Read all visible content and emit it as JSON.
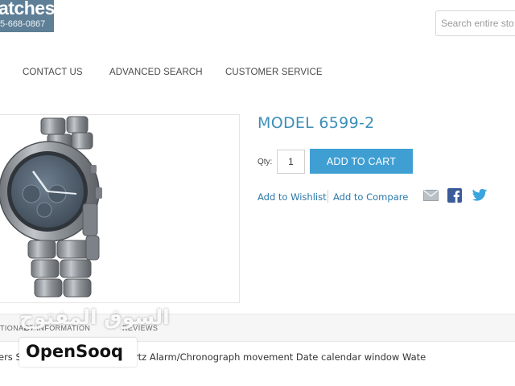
{
  "header": {
    "logo_text": "atches",
    "phone": "5-668-0867",
    "search_placeholder": "Search entire sto"
  },
  "nav": {
    "items": [
      "CONTACT US",
      "ADVANCED SEARCH",
      "CUSTOMER SERVICE"
    ]
  },
  "product": {
    "title": "MODEL 6599-2",
    "qty_label": "Qty:",
    "qty_value": "1",
    "add_to_cart": "ADD TO CART",
    "wishlist": "Add to Wishlist",
    "compare": "Add to Compare"
  },
  "social_icons": [
    "email-icon",
    "facebook-icon",
    "twitter-icon"
  ],
  "colors": {
    "accent": "#3f9fd3",
    "title": "#3b8fb8",
    "logo_bg": "#5f7f97",
    "link": "#2a78a8"
  },
  "tabs": {
    "items": [
      "TIONAL",
      "CT INFORMATION",
      "REVIEWS"
    ]
  },
  "description": "ers S                    l case and bracelet Quartz Alarm/Chronograph movement Date calendar window Wate",
  "watermark": {
    "arabic": "السوق المفتوح",
    "brand": "OpenSooq"
  }
}
